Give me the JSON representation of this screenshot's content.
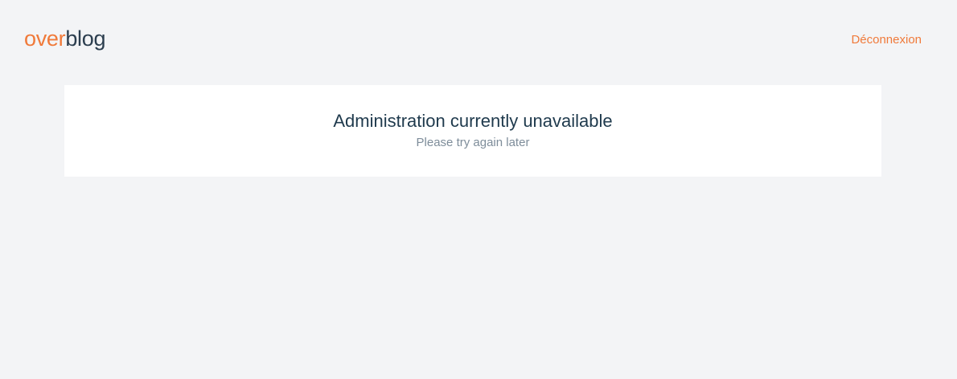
{
  "header": {
    "logo": {
      "part1": "over",
      "part2": "blog"
    },
    "logout_label": "Déconnexion"
  },
  "main": {
    "title": "Administration currently unavailable",
    "subtitle": "Please try again later"
  },
  "colors": {
    "accent": "#f07a3a",
    "logo_dark": "#2c3e4f",
    "title_text": "#1f3a4d",
    "subtitle_text": "#7e8d9a",
    "page_background": "#f3f4f6",
    "panel_background": "#ffffff"
  }
}
